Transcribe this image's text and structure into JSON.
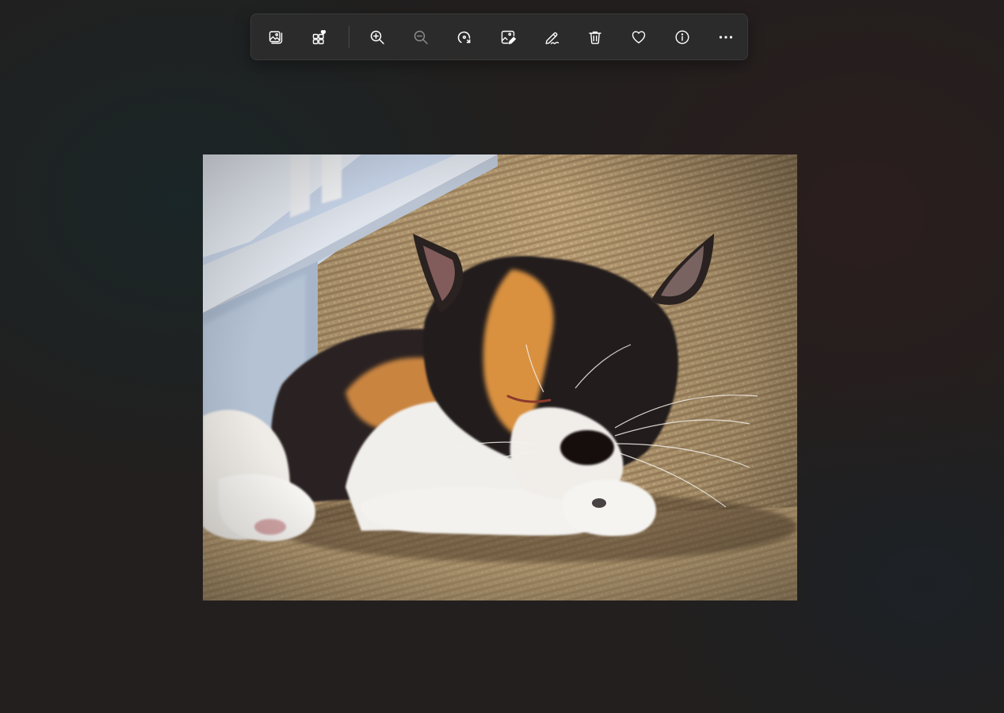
{
  "toolbar": {
    "buttons": [
      {
        "name": "view-all-photos",
        "icon": "image-gallery-icon",
        "enabled": true
      },
      {
        "name": "add-to-album",
        "icon": "apps-favorite-icon",
        "enabled": true
      },
      {
        "name": "zoom-in",
        "icon": "zoom-in-icon",
        "enabled": true
      },
      {
        "name": "zoom-out",
        "icon": "zoom-out-icon",
        "enabled": false
      },
      {
        "name": "rotate",
        "icon": "rotate-icon",
        "enabled": true
      },
      {
        "name": "edit-image",
        "icon": "edit-image-icon",
        "enabled": true
      },
      {
        "name": "draw",
        "icon": "pen-sign-icon",
        "enabled": true
      },
      {
        "name": "delete",
        "icon": "trash-icon",
        "enabled": true
      },
      {
        "name": "favorite",
        "icon": "heart-icon",
        "enabled": true
      },
      {
        "name": "file-info",
        "icon": "info-icon",
        "enabled": true
      },
      {
        "name": "see-more",
        "icon": "more-horizontal-icon",
        "enabled": true
      }
    ]
  },
  "viewer": {
    "image_subject": "calico-kitten-sleeping-on-carpet-stairs"
  },
  "colors": {
    "background": "#221f1e",
    "toolbar_bg": "#2b2b2b",
    "icon": "#ffffff"
  }
}
